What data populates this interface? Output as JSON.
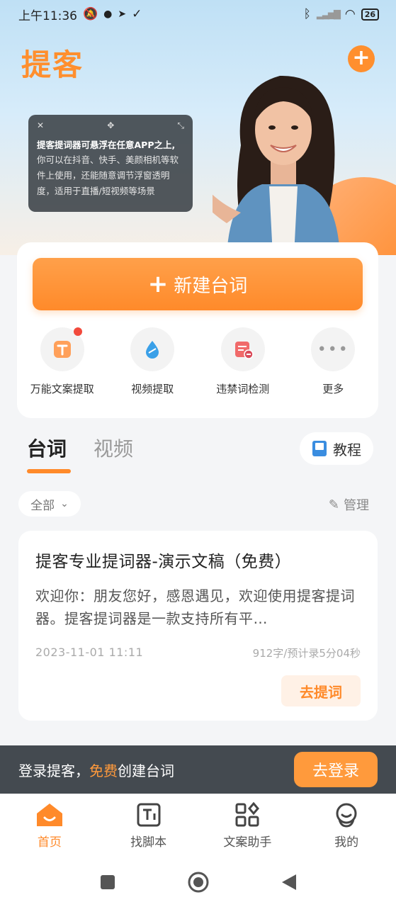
{
  "status_bar": {
    "time": "上午11:36",
    "battery": "26"
  },
  "hero": {
    "brand": "提客",
    "overlay": {
      "title": "提客提词器可悬浮在任意APP之上,",
      "body": "你可以在抖音、快手、美颜相机等软件上使用，还能随意调节浮窗透明度，适用于直播/短视频等场景"
    }
  },
  "main_card": {
    "create_label": "新建台词",
    "tools": [
      {
        "label": "万能文案提取",
        "icon": "text-extract-icon",
        "badge": true
      },
      {
        "label": "视频提取",
        "icon": "video-extract-icon",
        "badge": false
      },
      {
        "label": "违禁词检测",
        "icon": "forbidden-word-icon",
        "badge": false
      },
      {
        "label": "更多",
        "icon": "more-icon",
        "badge": false
      }
    ]
  },
  "tabs": {
    "items": [
      "台词",
      "视频"
    ],
    "active": "台词",
    "tutorial": "教程"
  },
  "filter": {
    "selected": "全部",
    "manage": "管理"
  },
  "script": {
    "title": "提客专业提词器-演示文稿（免费）",
    "preview": "欢迎你：朋友您好，感恩遇见，欢迎使用提客提词器。提客提词器是一款支持所有平…",
    "date": "2023-11-01 11:11",
    "meta": "912字/预计录5分04秒",
    "action": "去提词"
  },
  "login_banner": {
    "text_before": "登录提客，",
    "highlight": "免费",
    "text_after": "创建台词",
    "button": "去登录"
  },
  "bottom_nav": [
    {
      "label": "首页",
      "icon": "home-icon",
      "active": true
    },
    {
      "label": "找脚本",
      "icon": "script-icon",
      "active": false
    },
    {
      "label": "文案助手",
      "icon": "apps-icon",
      "active": false
    },
    {
      "label": "我的",
      "icon": "profile-icon",
      "active": false
    }
  ],
  "colors": {
    "accent": "#ff8a2a",
    "banner": "#444a50"
  }
}
